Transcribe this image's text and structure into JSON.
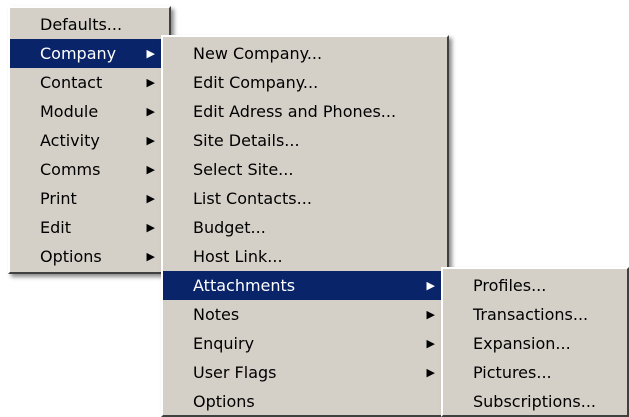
{
  "main_menu": {
    "items": [
      {
        "label": "Defaults...",
        "submenu": false,
        "selected": false
      },
      {
        "label": "Company",
        "submenu": true,
        "selected": true
      },
      {
        "label": "Contact",
        "submenu": true,
        "selected": false
      },
      {
        "label": "Module",
        "submenu": true,
        "selected": false
      },
      {
        "label": "Activity",
        "submenu": true,
        "selected": false
      },
      {
        "label": "Comms",
        "submenu": true,
        "selected": false
      },
      {
        "label": "Print",
        "submenu": true,
        "selected": false
      },
      {
        "label": "Edit",
        "submenu": true,
        "selected": false
      },
      {
        "label": "Options",
        "submenu": true,
        "selected": false
      }
    ]
  },
  "company_menu": {
    "items": [
      {
        "label": "New Company...",
        "submenu": false,
        "selected": false
      },
      {
        "label": "Edit Company...",
        "submenu": false,
        "selected": false
      },
      {
        "label": "Edit Adress and Phones...",
        "submenu": false,
        "selected": false
      },
      {
        "label": "Site Details...",
        "submenu": false,
        "selected": false
      },
      {
        "label": "Select Site...",
        "submenu": false,
        "selected": false
      },
      {
        "label": "List Contacts...",
        "submenu": false,
        "selected": false
      },
      {
        "label": "Budget...",
        "submenu": false,
        "selected": false
      },
      {
        "label": "Host Link...",
        "submenu": false,
        "selected": false
      },
      {
        "label": "Attachments",
        "submenu": true,
        "selected": true
      },
      {
        "label": "Notes",
        "submenu": true,
        "selected": false
      },
      {
        "label": "Enquiry",
        "submenu": true,
        "selected": false
      },
      {
        "label": "User Flags",
        "submenu": true,
        "selected": false
      },
      {
        "label": "Options",
        "submenu": false,
        "selected": false
      }
    ]
  },
  "attachments_menu": {
    "items": [
      {
        "label": "Profiles..."
      },
      {
        "label": "Transactions..."
      },
      {
        "label": "Expansion..."
      },
      {
        "label": "Pictures..."
      },
      {
        "label": "Subscriptions..."
      }
    ]
  },
  "icons": {
    "submenu_arrow": "▶"
  },
  "colors": {
    "menu_background": "#d4d0c8",
    "highlight_background": "#0a246a",
    "highlight_text": "#ffffff"
  }
}
